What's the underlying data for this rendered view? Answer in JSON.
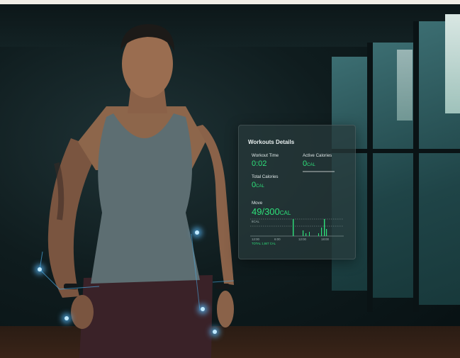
{
  "panel": {
    "title": "Workouts Details",
    "workout_time_label": "Workout Time",
    "workout_time_value": "0:02",
    "active_calories_label": "Active Calories",
    "active_calories_value": "0",
    "active_calories_unit": "CAL",
    "total_calories_label": "Total Calories",
    "total_calories_value": "0",
    "total_calories_unit": "CAL",
    "move_label": "Move",
    "move_value": "49/300",
    "move_unit": "CAL",
    "chart_unit_label": "8CAL",
    "ticks": [
      "12:00",
      "6:00",
      "12:00",
      "18:00"
    ],
    "total_label": "TOTAL 1,847 CAL"
  },
  "colors": {
    "accent": "#2ee07a",
    "panel": "#283a3c",
    "glow": "#5abeff"
  }
}
